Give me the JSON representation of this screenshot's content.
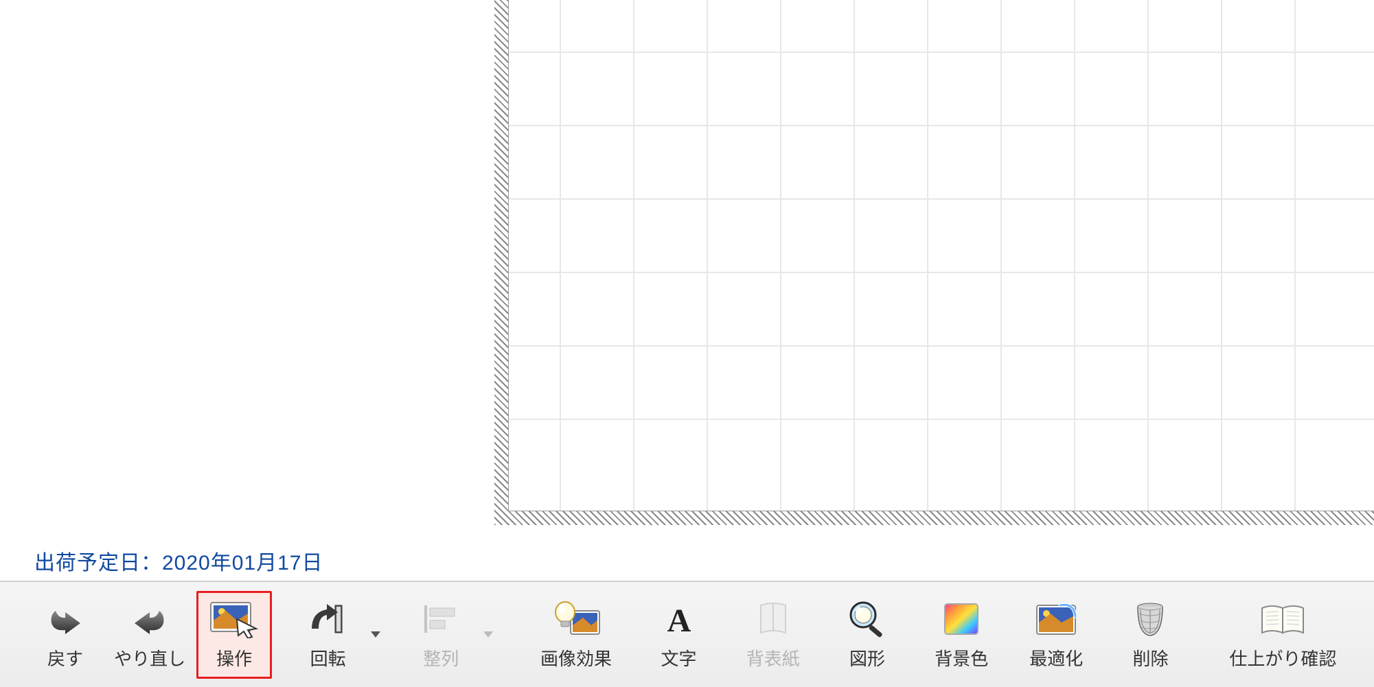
{
  "status": {
    "shipping_label": "出荷予定日：",
    "shipping_date": "2020年01月17日"
  },
  "toolbar": {
    "undo": "戻す",
    "redo": "やり直し",
    "operate": "操作",
    "rotate": "回転",
    "align": "整列",
    "image_effect": "画像効果",
    "text": "文字",
    "spine": "背表紙",
    "shape": "図形",
    "bg_color": "背景色",
    "optimize": "最適化",
    "delete": "削除",
    "preview": "仕上がり確認"
  },
  "colors": {
    "accent_blue": "#1048a0",
    "selected_red": "#e81e1e",
    "selected_bg": "#fce8e4"
  },
  "icons": {
    "undo": "undo-arrow-icon",
    "redo": "redo-arrow-icon",
    "operate": "image-cursor-icon",
    "rotate": "rotate-icon",
    "align": "align-left-icon",
    "image_effect": "lightbulb-image-icon",
    "text": "text-a-icon",
    "spine": "book-spine-icon",
    "shape": "shape-magnifier-icon",
    "bg_color": "color-swatch-icon",
    "optimize": "image-optimize-icon",
    "delete": "trash-icon",
    "preview": "open-book-icon"
  }
}
